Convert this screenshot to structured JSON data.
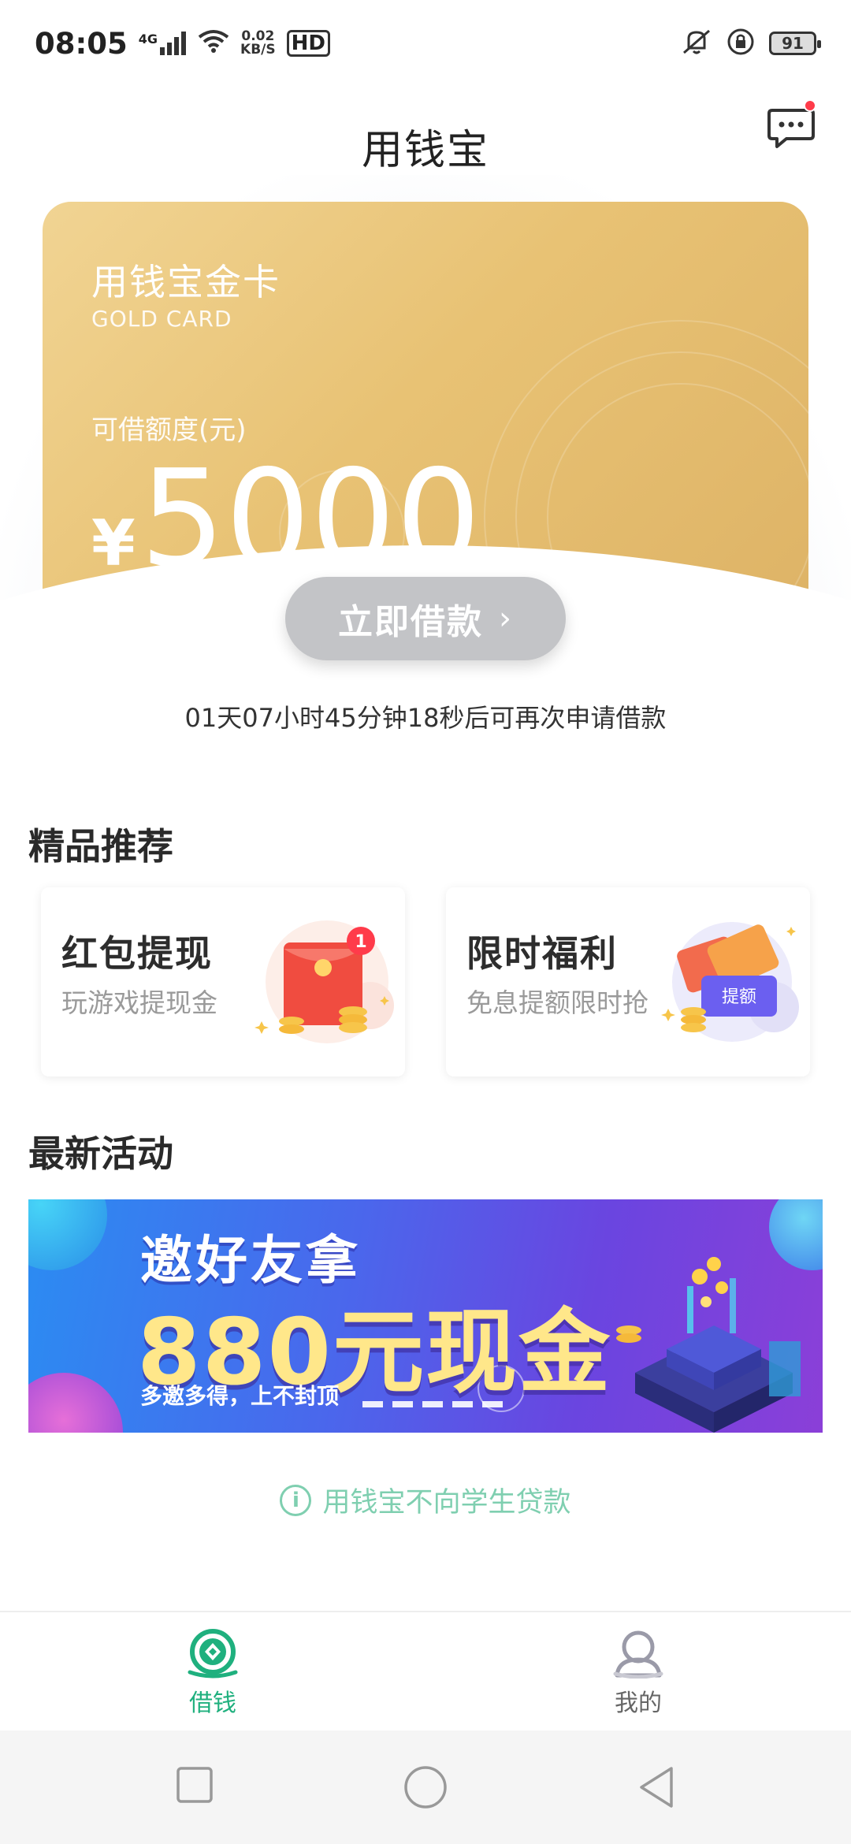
{
  "status_bar": {
    "time": "08:05",
    "network_type": "4G",
    "speed_value": "0.02",
    "speed_unit": "KB/S",
    "hd": "HD",
    "battery": "91",
    "icons": [
      "signal-icon",
      "wifi-icon",
      "vibrate-icon",
      "rotation-lock-icon",
      "battery-icon"
    ]
  },
  "header": {
    "title": "用钱宝",
    "message_icon": "message-bubble-icon",
    "has_unread_dot": true
  },
  "gold_card": {
    "title": "用钱宝金卡",
    "subtitle": "GOLD CARD",
    "limit_label": "可借额度(元)",
    "currency_symbol": "¥",
    "amount": "5000"
  },
  "borrow_button": {
    "label": "立即借款",
    "chevron": "›"
  },
  "countdown_text": "01天07小时45分钟18秒后可再次申请借款",
  "recommend_section": {
    "title": "精品推荐",
    "cards": [
      {
        "title": "红包提现",
        "desc": "玩游戏提现金",
        "icon": "red-envelope-icon",
        "badge": "1"
      },
      {
        "title": "限时福利",
        "desc": "免息提额限时抢",
        "icon": "coupon-icon",
        "badge_text": "提额"
      }
    ]
  },
  "activity_section": {
    "title": "最新活动",
    "banner": {
      "line1": "邀好友拿",
      "line2": "880元现金",
      "line3": "多邀多得，上不封顶"
    }
  },
  "notice": {
    "icon": "info-icon",
    "text": "用钱宝不向学生贷款"
  },
  "tab_bar": {
    "tabs": [
      {
        "label": "借钱",
        "icon": "borrow-icon",
        "active": true
      },
      {
        "label": "我的",
        "icon": "profile-icon",
        "active": false
      }
    ]
  },
  "nav_bar": {
    "buttons": [
      "recents-icon",
      "home-icon",
      "back-icon"
    ]
  },
  "colors": {
    "accent_green": "#1fb07e",
    "notice_green": "#7fcfb0",
    "gold": "#e8c274",
    "button_gray": "#c3c4c7",
    "unread_red": "#ff3b4a"
  }
}
